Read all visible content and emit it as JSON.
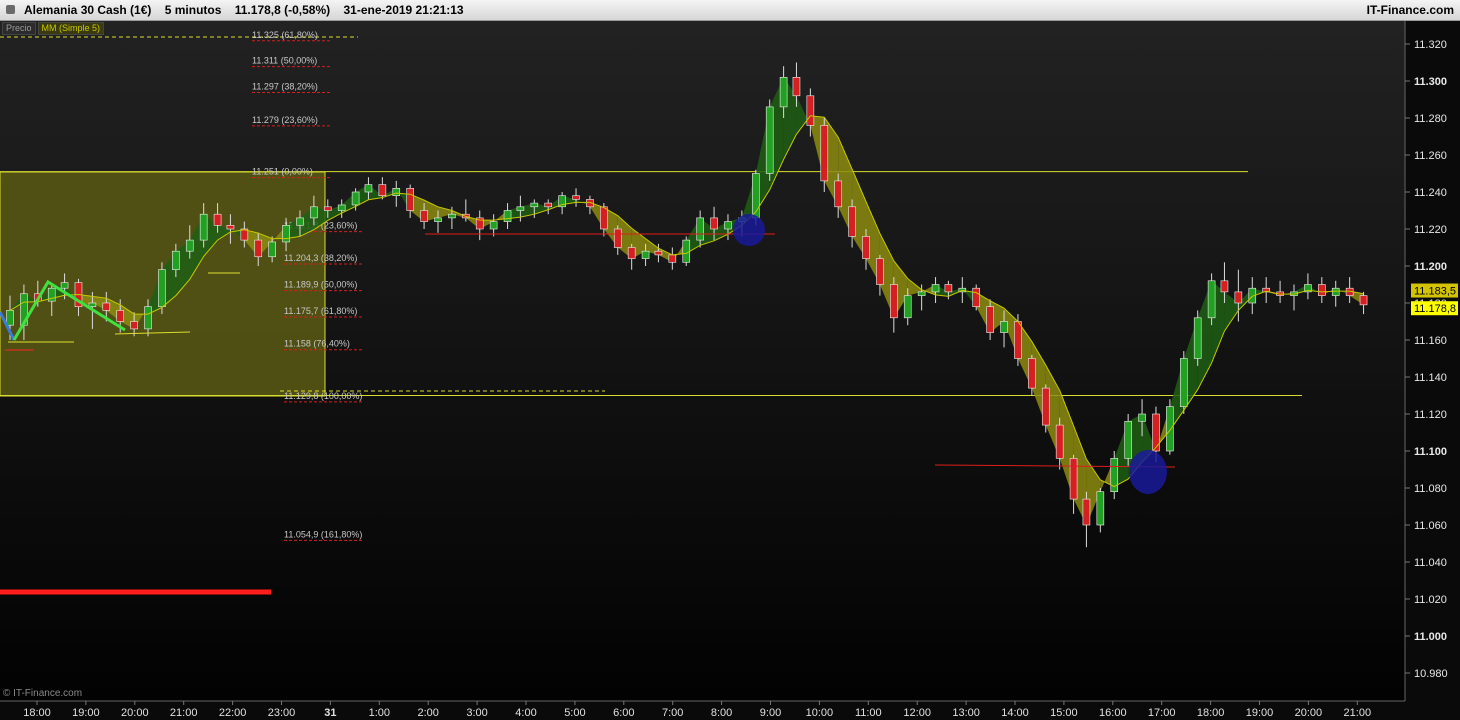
{
  "header": {
    "instrument": "Alemania 30 Cash (1€)",
    "timeframe": "5 minutos",
    "last": "11.178,8 (-0,58%)",
    "datetime": "31-ene-2019 21:21:13",
    "brand": "IT-Finance.com"
  },
  "legend": {
    "price": "Precio",
    "ma": "MM (Simple 5)"
  },
  "copyright": "© IT-Finance.com",
  "colors": {
    "up": "#22a022",
    "down": "#d42020",
    "ma": "#c8c800",
    "accent_red": "#ff2020",
    "fib": "#dcdc30",
    "zone": "#5a5a14",
    "circle": "#1a1a9a"
  },
  "chart_data": {
    "type": "candlestick",
    "ylim": [
      10970,
      11325
    ],
    "y_ticks": [
      "11.320",
      "11.300",
      "11.280",
      "11.260",
      "11.240",
      "11.220",
      "11.200",
      "11.180",
      "11.160",
      "11.140",
      "11.120",
      "11.100",
      "11.080",
      "11.060",
      "11.040",
      "11.020",
      "11.000",
      "10.980"
    ],
    "x_ticks": [
      "18:00",
      "19:00",
      "20:00",
      "21:00",
      "22:00",
      "23:00",
      "31",
      "1:00",
      "2:00",
      "3:00",
      "4:00",
      "5:00",
      "6:00",
      "7:00",
      "8:00",
      "9:00",
      "10:00",
      "11:00",
      "12:00",
      "13:00",
      "14:00",
      "15:00",
      "16:00",
      "17:00",
      "18:00",
      "19:00",
      "20:00",
      "21:00"
    ],
    "price_tags": [
      {
        "label": "11.183,5",
        "value": 11183.5,
        "color": "#d4c400"
      },
      {
        "label": "11.178,8",
        "value": 11178.8,
        "color": "#ffff00"
      }
    ],
    "fib_labels": [
      {
        "text": "11.325 (61,80%)",
        "value": 11325
      },
      {
        "text": "11.311 (50,00%)",
        "value": 11311
      },
      {
        "text": "11.297 (38,20%)",
        "value": 11297
      },
      {
        "text": "11.279 (23,60%)",
        "value": 11279
      },
      {
        "text": "11.251 (0,00%)",
        "value": 11251
      },
      {
        "text": "11.221,8 (23,60%)",
        "value": 11221.8
      },
      {
        "text": "11.204,3 (38,20%)",
        "value": 11204.3
      },
      {
        "text": "11.189,9 (50,00%)",
        "value": 11189.9
      },
      {
        "text": "11.175,7 (61,80%)",
        "value": 11175.7
      },
      {
        "text": "11.158 (76,40%)",
        "value": 11158
      },
      {
        "text": "11.129,8 (100,00%)",
        "value": 11129.8
      },
      {
        "text": "11.054,9 (161,80%)",
        "value": 11054.9
      }
    ],
    "fib_levels": [
      11251,
      11130
    ],
    "candles": [
      [
        0.0,
        11168,
        11184,
        11160,
        11176
      ],
      [
        1.3,
        11168,
        11190,
        11160,
        11185
      ],
      [
        2.6,
        11185,
        11192,
        11178,
        11181
      ],
      [
        3.9,
        11181,
        11190,
        11173,
        11188
      ],
      [
        5.1,
        11188,
        11196,
        11182,
        11191
      ],
      [
        6.4,
        11191,
        11193,
        11173,
        11178
      ],
      [
        7.7,
        11178,
        11186,
        11166,
        11180
      ],
      [
        9.0,
        11180,
        11186,
        11170,
        11176
      ],
      [
        10.3,
        11176,
        11182,
        11164,
        11170
      ],
      [
        11.6,
        11170,
        11175,
        11162,
        11166
      ],
      [
        12.9,
        11166,
        11182,
        11162,
        11178
      ],
      [
        14.2,
        11178,
        11202,
        11174,
        11198
      ],
      [
        15.5,
        11198,
        11212,
        11194,
        11208
      ],
      [
        16.8,
        11208,
        11222,
        11204,
        11214
      ],
      [
        18.1,
        11214,
        11234,
        11210,
        11228
      ],
      [
        19.4,
        11228,
        11234,
        11218,
        11222
      ],
      [
        20.6,
        11222,
        11228,
        11212,
        11220
      ],
      [
        21.9,
        11220,
        11224,
        11210,
        11214
      ],
      [
        23.2,
        11214,
        11218,
        11200,
        11205
      ],
      [
        24.5,
        11205,
        11216,
        11202,
        11213
      ],
      [
        25.8,
        11213,
        11226,
        11208,
        11222
      ],
      [
        27.1,
        11222,
        11230,
        11216,
        11226
      ],
      [
        28.4,
        11226,
        11238,
        11222,
        11232
      ],
      [
        29.7,
        11232,
        11236,
        11226,
        11230
      ],
      [
        31.0,
        11230,
        11236,
        11226,
        11233
      ],
      [
        32.3,
        11233,
        11242,
        11230,
        11240
      ],
      [
        33.5,
        11240,
        11248,
        11236,
        11244
      ],
      [
        34.8,
        11244,
        11248,
        11236,
        11238
      ],
      [
        36.1,
        11238,
        11246,
        11232,
        11242
      ],
      [
        37.4,
        11242,
        11244,
        11226,
        11230
      ],
      [
        38.7,
        11230,
        11234,
        11220,
        11224
      ],
      [
        40.0,
        11224,
        11230,
        11218,
        11226
      ],
      [
        41.3,
        11226,
        11232,
        11220,
        11228
      ],
      [
        42.6,
        11228,
        11236,
        11224,
        11226
      ],
      [
        43.9,
        11226,
        11230,
        11214,
        11220
      ],
      [
        45.2,
        11220,
        11228,
        11216,
        11224
      ],
      [
        46.5,
        11224,
        11234,
        11220,
        11230
      ],
      [
        47.7,
        11230,
        11238,
        11224,
        11232
      ],
      [
        49.0,
        11232,
        11236,
        11226,
        11234
      ],
      [
        50.3,
        11234,
        11236,
        11228,
        11232
      ],
      [
        51.6,
        11232,
        11240,
        11228,
        11238
      ],
      [
        52.9,
        11238,
        11242,
        11232,
        11236
      ],
      [
        54.2,
        11236,
        11238,
        11228,
        11232
      ],
      [
        55.5,
        11232,
        11234,
        11216,
        11220
      ],
      [
        56.8,
        11220,
        11222,
        11206,
        11210
      ],
      [
        58.1,
        11210,
        11212,
        11198,
        11204
      ],
      [
        59.4,
        11204,
        11212,
        11200,
        11208
      ],
      [
        60.6,
        11208,
        11212,
        11202,
        11206
      ],
      [
        61.9,
        11206,
        11210,
        11198,
        11202
      ],
      [
        63.2,
        11202,
        11216,
        11200,
        11214
      ],
      [
        64.5,
        11214,
        11230,
        11210,
        11226
      ],
      [
        65.8,
        11226,
        11232,
        11214,
        11220
      ],
      [
        67.1,
        11220,
        11228,
        11214,
        11224
      ],
      [
        68.4,
        11224,
        11230,
        11216,
        11226
      ],
      [
        69.7,
        11226,
        11252,
        11222,
        11250
      ],
      [
        71.0,
        11250,
        11290,
        11246,
        11286
      ],
      [
        72.3,
        11286,
        11308,
        11280,
        11302
      ],
      [
        73.5,
        11302,
        11310,
        11286,
        11292
      ],
      [
        74.8,
        11292,
        11296,
        11270,
        11276
      ],
      [
        76.1,
        11276,
        11280,
        11240,
        11246
      ],
      [
        77.4,
        11246,
        11250,
        11226,
        11232
      ],
      [
        78.7,
        11232,
        11236,
        11210,
        11216
      ],
      [
        80.0,
        11216,
        11220,
        11198,
        11204
      ],
      [
        81.3,
        11204,
        11206,
        11184,
        11190
      ],
      [
        82.6,
        11190,
        11194,
        11164,
        11172
      ],
      [
        83.9,
        11172,
        11188,
        11168,
        11184
      ],
      [
        85.2,
        11184,
        11190,
        11176,
        11186
      ],
      [
        86.5,
        11186,
        11194,
        11180,
        11190
      ],
      [
        87.7,
        11190,
        11192,
        11182,
        11186
      ],
      [
        89.0,
        11186,
        11194,
        11180,
        11188
      ],
      [
        90.3,
        11188,
        11190,
        11176,
        11178
      ],
      [
        91.6,
        11178,
        11182,
        11160,
        11164
      ],
      [
        92.9,
        11164,
        11176,
        11156,
        11170
      ],
      [
        94.2,
        11170,
        11174,
        11146,
        11150
      ],
      [
        95.5,
        11150,
        11152,
        11130,
        11134
      ],
      [
        96.8,
        11134,
        11136,
        11110,
        11114
      ],
      [
        98.1,
        11114,
        11118,
        11090,
        11096
      ],
      [
        99.4,
        11096,
        11098,
        11066,
        11074
      ],
      [
        100.6,
        11074,
        11078,
        11048,
        11060
      ],
      [
        101.9,
        11060,
        11080,
        11056,
        11078
      ],
      [
        103.2,
        11078,
        11100,
        11074,
        11096
      ],
      [
        104.5,
        11096,
        11120,
        11092,
        11116
      ],
      [
        105.8,
        11116,
        11128,
        11108,
        11120
      ],
      [
        107.1,
        11120,
        11124,
        11094,
        11100
      ],
      [
        108.4,
        11100,
        11128,
        11098,
        11124
      ],
      [
        109.7,
        11124,
        11154,
        11120,
        11150
      ],
      [
        111.0,
        11150,
        11176,
        11146,
        11172
      ],
      [
        112.3,
        11172,
        11196,
        11168,
        11192
      ],
      [
        113.5,
        11192,
        11202,
        11180,
        11186
      ],
      [
        114.8,
        11186,
        11198,
        11170,
        11180
      ],
      [
        116.1,
        11180,
        11194,
        11174,
        11188
      ],
      [
        117.4,
        11188,
        11194,
        11180,
        11186
      ],
      [
        118.7,
        11186,
        11192,
        11180,
        11184
      ],
      [
        120.0,
        11184,
        11190,
        11176,
        11186
      ],
      [
        121.3,
        11186,
        11196,
        11182,
        11190
      ],
      [
        122.6,
        11190,
        11194,
        11180,
        11184
      ],
      [
        123.9,
        11184,
        11192,
        11178,
        11188
      ],
      [
        125.2,
        11188,
        11194,
        11180,
        11184
      ],
      [
        126.5,
        11184,
        11186,
        11174,
        11179
      ]
    ]
  }
}
